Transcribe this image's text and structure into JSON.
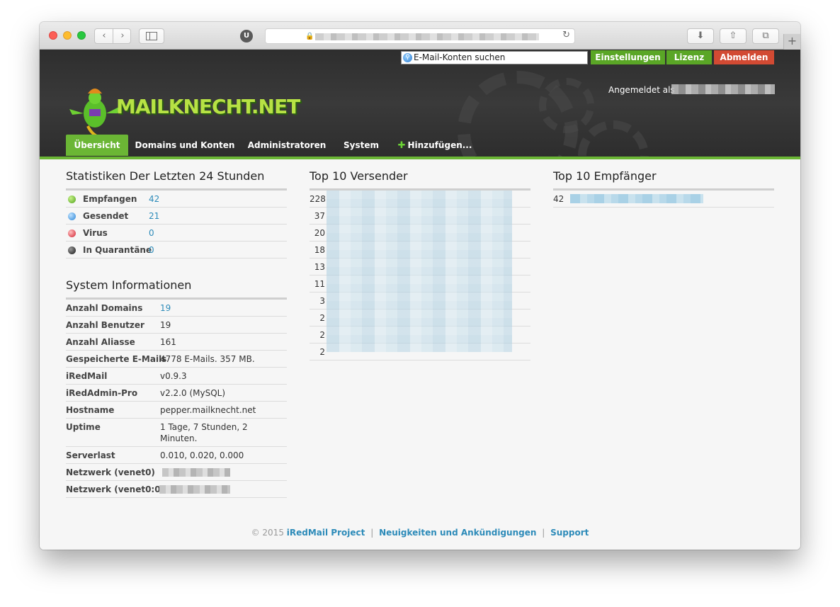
{
  "browser": {
    "nav_back": "‹",
    "nav_forward": "›",
    "reload_glyph": "↻",
    "ext_badge": "U",
    "download_glyph": "⬇",
    "share_glyph": "⇧",
    "tabs_glyph": "⧉",
    "newtab_glyph": "+"
  },
  "header": {
    "search_placeholder": "E-Mail-Konten suchen",
    "buttons": {
      "settings": "Einstellungen",
      "license": "Lizenz",
      "logout": "Abmelden"
    },
    "logo_text": "MAILKNECHT.NET",
    "logged_in_label": "Angemeldet als",
    "nav": [
      {
        "label": "Übersicht"
      },
      {
        "label": "Domains und Konten"
      },
      {
        "label": "Administratoren"
      },
      {
        "label": "System"
      },
      {
        "label": "Hinzufügen..."
      }
    ],
    "accent_green": "#6bb635",
    "logout_red": "#d24a33"
  },
  "stats": {
    "title": "Statistiken Der Letzten 24 Stunden",
    "rows": [
      {
        "label": "Empfangen",
        "value": "42",
        "color": "green"
      },
      {
        "label": "Gesendet",
        "value": "21",
        "color": "blue"
      },
      {
        "label": "Virus",
        "value": "0",
        "color": "red"
      },
      {
        "label": "In Quarantäne",
        "value": "0",
        "color": "black"
      }
    ]
  },
  "system": {
    "title": "System Informationen",
    "rows": [
      {
        "label": "Anzahl Domains",
        "value": "19"
      },
      {
        "label": "Anzahl Benutzer",
        "value": "19"
      },
      {
        "label": "Anzahl Aliasse",
        "value": "161"
      },
      {
        "label": "Gespeicherte E-Mails",
        "value": "4778 E-Mails. 357 MB."
      },
      {
        "label": "iRedMail",
        "value": "v0.9.3"
      },
      {
        "label": "iRedAdmin-Pro",
        "value": "v2.2.0 (MySQL)"
      },
      {
        "label": "Hostname",
        "value": "pepper.mailknecht.net"
      },
      {
        "label": "Uptime",
        "value": "1 Tage, 7 Stunden, 2 Minuten."
      },
      {
        "label": "Serverlast",
        "value": "0.010, 0.020, 0.000"
      },
      {
        "label": "Netzwerk (venet0)",
        "value": ""
      },
      {
        "label": "Netzwerk (venet0:0)",
        "value": ""
      }
    ]
  },
  "senders": {
    "title": "Top 10 Versender",
    "counts": [
      "228",
      "37",
      "20",
      "18",
      "13",
      "11",
      "3",
      "2",
      "2",
      "2"
    ]
  },
  "recipients": {
    "title": "Top 10 Empfänger",
    "counts": [
      "42"
    ]
  },
  "footer": {
    "copyright": "© 2015",
    "project": "iRedMail Project",
    "news": "Neuigkeiten und Ankündigungen",
    "support": "Support",
    "separator": "|"
  }
}
